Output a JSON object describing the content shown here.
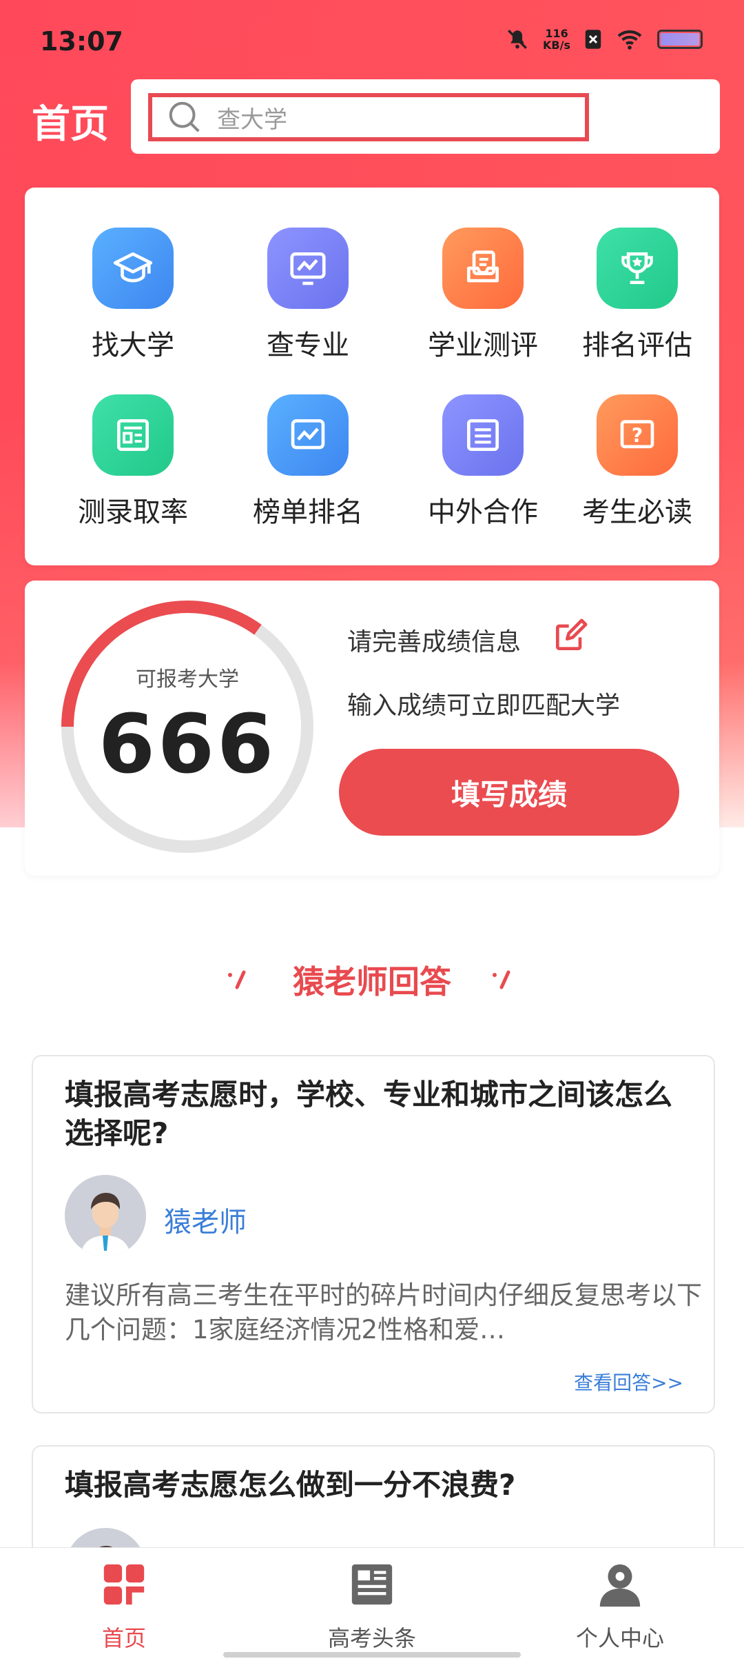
{
  "status_bar": {
    "time": "13:07",
    "net_speed_value": "116",
    "net_speed_unit": "KB/s"
  },
  "header": {
    "title": "首页",
    "search_placeholder": "查大学"
  },
  "grid": {
    "items": [
      {
        "label": "找大学",
        "icon": "graduation-cap-icon",
        "color": "#4f9bf5"
      },
      {
        "label": "查专业",
        "icon": "chart-monitor-icon",
        "color": "#7b83f3"
      },
      {
        "label": "学业测评",
        "icon": "assessment-icon",
        "color": "#ff7b45"
      },
      {
        "label": "排名评估",
        "icon": "trophy-icon",
        "color": "#2fd59a"
      },
      {
        "label": "测录取率",
        "icon": "newspaper-icon",
        "color": "#2fd59a"
      },
      {
        "label": "榜单排名",
        "icon": "line-chart-icon",
        "color": "#4f9bf5"
      },
      {
        "label": "中外合作",
        "icon": "list-doc-icon",
        "color": "#7b83f3"
      },
      {
        "label": "考生必读",
        "icon": "question-icon",
        "color": "#ff7b45"
      }
    ]
  },
  "score": {
    "ring_label": "可报考大学",
    "count": "666",
    "ring_progress": 0.35,
    "tip_title": "请完善成绩信息",
    "tip_sub": "输入成绩可立即匹配大学",
    "button": "填写成绩"
  },
  "section": {
    "title": "猿老师回答"
  },
  "questions": [
    {
      "title": "填报高考志愿时，学校、专业和城市之间该怎么选择呢?",
      "author": "猿老师",
      "excerpt": "建议所有高三考生在平时的碎片时间内仔细反复思考以下几个问题：1家庭经济情况2性格和爱…",
      "more": "查看回答>>"
    },
    {
      "title": "填报高考志愿怎么做到一分不浪费?"
    }
  ],
  "tabbar": {
    "tabs": [
      {
        "label": "首页",
        "icon": "home-icon"
      },
      {
        "label": "高考头条",
        "icon": "news-icon"
      },
      {
        "label": "个人中心",
        "icon": "user-icon"
      }
    ]
  },
  "colors": {
    "accent": "#ea4c50",
    "link": "#3b7ed8"
  }
}
